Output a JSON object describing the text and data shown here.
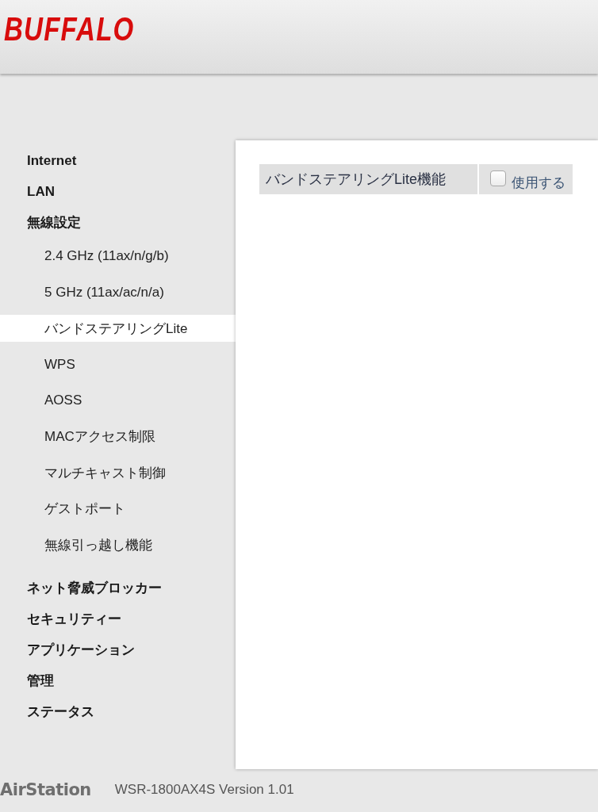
{
  "header": {
    "logo": "BUFFALO"
  },
  "sidebar": {
    "items": [
      {
        "label": "Internet",
        "selected": false
      },
      {
        "label": "LAN",
        "selected": false
      },
      {
        "label": "無線設定",
        "selected": false,
        "children": [
          {
            "label": "2.4 GHz (11ax/n/g/b)",
            "selected": false
          },
          {
            "label": "5 GHz (11ax/ac/n/a)",
            "selected": false
          },
          {
            "label": "バンドステアリングLite",
            "selected": true
          },
          {
            "label": "WPS",
            "selected": false
          },
          {
            "label": "AOSS",
            "selected": false
          },
          {
            "label": "MACアクセス制限",
            "selected": false
          },
          {
            "label": "マルチキャスト制御",
            "selected": false
          },
          {
            "label": "ゲストポート",
            "selected": false
          },
          {
            "label": "無線引っ越し機能",
            "selected": false
          }
        ]
      },
      {
        "label": "ネット脅威ブロッカー",
        "selected": false
      },
      {
        "label": "セキュリティー",
        "selected": false
      },
      {
        "label": "アプリケーション",
        "selected": false
      },
      {
        "label": "管理",
        "selected": false
      },
      {
        "label": "ステータス",
        "selected": false
      }
    ]
  },
  "content": {
    "settings": [
      {
        "label": "バンドステアリングLite機能",
        "option": "使用する",
        "checked": false
      }
    ]
  },
  "footer": {
    "logo": "AirStation",
    "version": "WSR-1800AX4S Version 1.01"
  }
}
